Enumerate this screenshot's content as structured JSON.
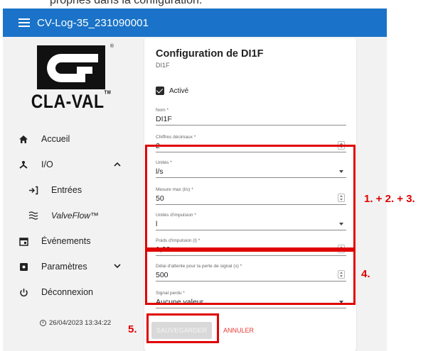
{
  "top_snippet": "propriés dans la configuration.",
  "header": {
    "title": "CV-Log-35_231090001"
  },
  "logo": {
    "text": "CLA-VAL",
    "trademark": "TM",
    "registered": "®"
  },
  "sidebar": {
    "items": [
      {
        "label": "Accueil",
        "icon": "home-icon"
      },
      {
        "label": "I/O",
        "icon": "io-icon"
      },
      {
        "label": "Entrées",
        "icon": "input-icon"
      },
      {
        "label": "ValveFlow™",
        "icon": "waves-icon"
      },
      {
        "label": "Événements",
        "icon": "calendar-icon"
      },
      {
        "label": "Paramètres",
        "icon": "settings-icon"
      },
      {
        "label": "Déconnexion",
        "icon": "power-icon"
      }
    ],
    "datetime": "26/04/2023 13:34:22"
  },
  "card": {
    "title": "Configuration de DI1F",
    "subtitle": "DI1F",
    "active_label": "Activé",
    "fields": {
      "nom": {
        "label": "Nom *",
        "value": "DI1F"
      },
      "decimales": {
        "label": "Chiffres décimaux *",
        "value": "2"
      },
      "unites": {
        "label": "Unités *",
        "value": "l/s"
      },
      "mesure_max": {
        "label": "Mesure max (l/s) *",
        "value": "50"
      },
      "unites_impulsion": {
        "label": "Unités d'impulsion *",
        "value": "l"
      },
      "poids_impulsion": {
        "label": "Poids d'impulsion (l) *",
        "value": "1,00"
      },
      "delai": {
        "label": "Délai d'attente pour la perte de signal (s) *",
        "value": "500"
      },
      "signal_perdu": {
        "label": "Signal perdu *",
        "value": "Aucune valeur"
      }
    },
    "save_label": "SAUVEGARDER",
    "cancel_label": "ANNULER"
  },
  "annotations": {
    "a123": "1. + 2. + 3.",
    "a4": "4.",
    "a5": "5.",
    "color": "#e00000"
  },
  "colors": {
    "header": "#1a73c8",
    "cancel": "#e53935"
  }
}
